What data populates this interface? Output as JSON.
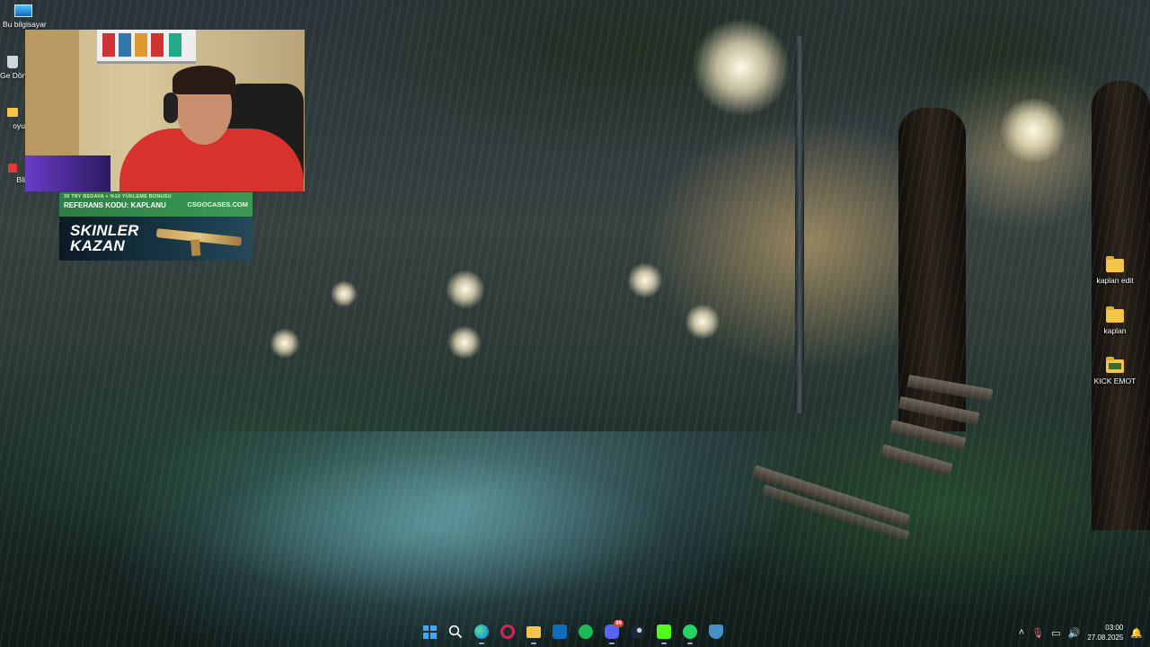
{
  "desktop": {
    "left_icons": [
      {
        "label": "Bu bilgisayar",
        "icon": "this-pc-icon"
      },
      {
        "label": "Ge Dönü",
        "icon": "recycle-bin-icon"
      },
      {
        "label": "oyu",
        "icon": "folder-icon"
      },
      {
        "label": "Bli",
        "icon": "app-shortcut-icon"
      }
    ],
    "right_icons": [
      {
        "label": "kaplan edit",
        "icon": "folder-icon"
      },
      {
        "label": "kaplan",
        "icon": "folder-icon"
      },
      {
        "label": "KICK EMOT",
        "icon": "image-folder-icon"
      }
    ]
  },
  "promo": {
    "bonus_text": "30 TRY BEDAVA + %10 YÜKLEME BONUSU",
    "code_text": "REFERANS KODU: KAPLANU",
    "site": "CSGOCASES.COM",
    "headline_1": "SKINLER",
    "headline_2": "KAZAN"
  },
  "taskbar": {
    "apps": [
      {
        "name": "start",
        "icon": "windows-start-icon"
      },
      {
        "name": "search",
        "icon": "search-icon"
      },
      {
        "name": "edge",
        "icon": "edge-browser-icon",
        "color": "#1fa3d6"
      },
      {
        "name": "opera",
        "icon": "opera-gx-icon",
        "color": "#d6245a"
      },
      {
        "name": "explorer",
        "icon": "file-explorer-icon",
        "color": "#f4c44c"
      },
      {
        "name": "outlook",
        "icon": "outlook-icon",
        "color": "#0f6cbd"
      },
      {
        "name": "spotify",
        "icon": "spotify-icon",
        "color": "#1db954"
      },
      {
        "name": "discord",
        "icon": "discord-icon",
        "color": "#5865f2",
        "badge": "99"
      },
      {
        "name": "steam",
        "icon": "steam-icon",
        "color": "#1b2838"
      },
      {
        "name": "kick",
        "icon": "kick-app-icon",
        "color": "#53fc18"
      },
      {
        "name": "whatsapp",
        "icon": "whatsapp-icon",
        "color": "#25d366"
      },
      {
        "name": "vpn",
        "icon": "shield-app-icon",
        "color": "#4a90c8"
      }
    ],
    "tray": {
      "time": "03:00",
      "date": "27.08.2025"
    }
  }
}
